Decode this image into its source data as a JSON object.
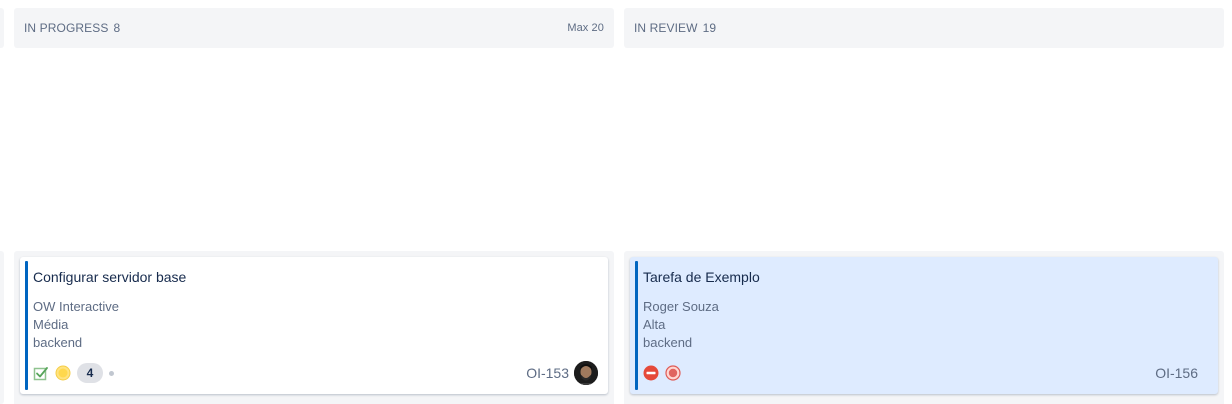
{
  "columns": [
    {
      "name": "IN PROGRESS",
      "count": "8",
      "max": "Max 20",
      "card": {
        "title": "Configurar servidor base",
        "fields": [
          "OW Interactive",
          "Média",
          "backend"
        ],
        "estimate": "4",
        "key": "OI-153",
        "icons": [
          "subtask-checkbox-icon",
          "priority-medium-icon"
        ]
      }
    },
    {
      "name": "IN REVIEW",
      "count": "19",
      "max": "",
      "card": {
        "title": "Tarefa de Exemplo",
        "fields": [
          "Roger Souza",
          "Alta",
          "backend"
        ],
        "key": "OI-156",
        "icons": [
          "blocker-icon",
          "priority-high-icon"
        ]
      }
    }
  ],
  "colors": {
    "column_bg": "#f4f5f7",
    "card_accent": "#0065c0",
    "card_highlight": "#deebff"
  }
}
